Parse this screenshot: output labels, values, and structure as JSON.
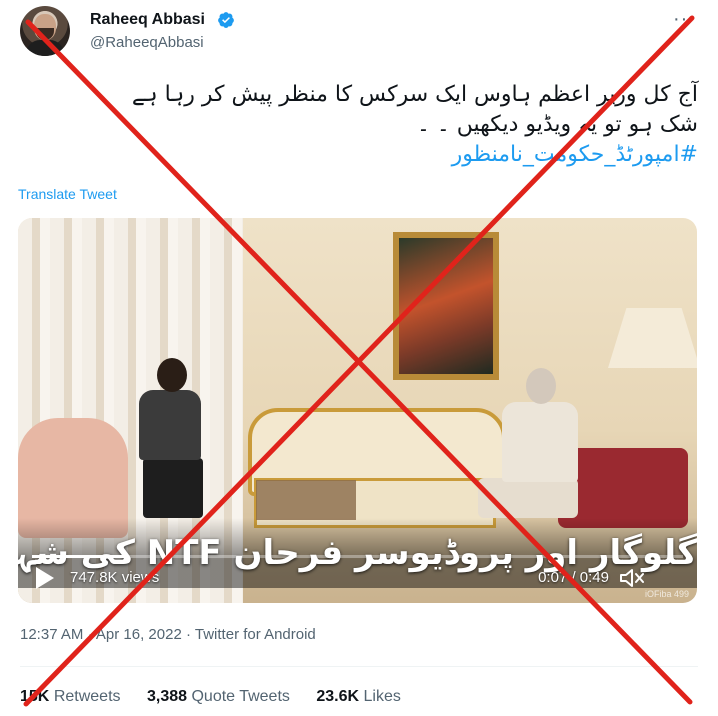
{
  "author": {
    "name": "Raheeq Abbasi",
    "handle": "@RaheeqAbbasi",
    "verified_icon": "verified-badge-icon",
    "more_label": "···"
  },
  "tweet": {
    "line1": "آج کل وزیر اعظم ہاوس ایک سرکس کا منظر پیش کر رہا ہے",
    "line2": "شک ہو تو یہ ویڈیو دیکھیں ۔ ۔",
    "hashtag": "#امپورٹڈ_حکومت_نامنظور"
  },
  "translate_label": "Translate Tweet",
  "video": {
    "subtitle": "گلوگار اور پروڈیوسر فرحان NTF کی شہباز شریف سے ملاقات",
    "views_label": "747.8K views",
    "time_label": "0:07 / 0:49",
    "progress": 0.143,
    "watermark": "iOFiba 499"
  },
  "meta": {
    "time": "12:37 AM",
    "date": "Apr 16, 2022",
    "source": "Twitter for Android",
    "separator": "·"
  },
  "stats": {
    "retweets_count": "15K",
    "retweets_label": "Retweets",
    "quotes_count": "3,388",
    "quotes_label": "Quote Tweets",
    "likes_count": "23.6K",
    "likes_label": "Likes"
  },
  "colors": {
    "accent": "#1d9bf0",
    "cross": "#e0231b"
  }
}
